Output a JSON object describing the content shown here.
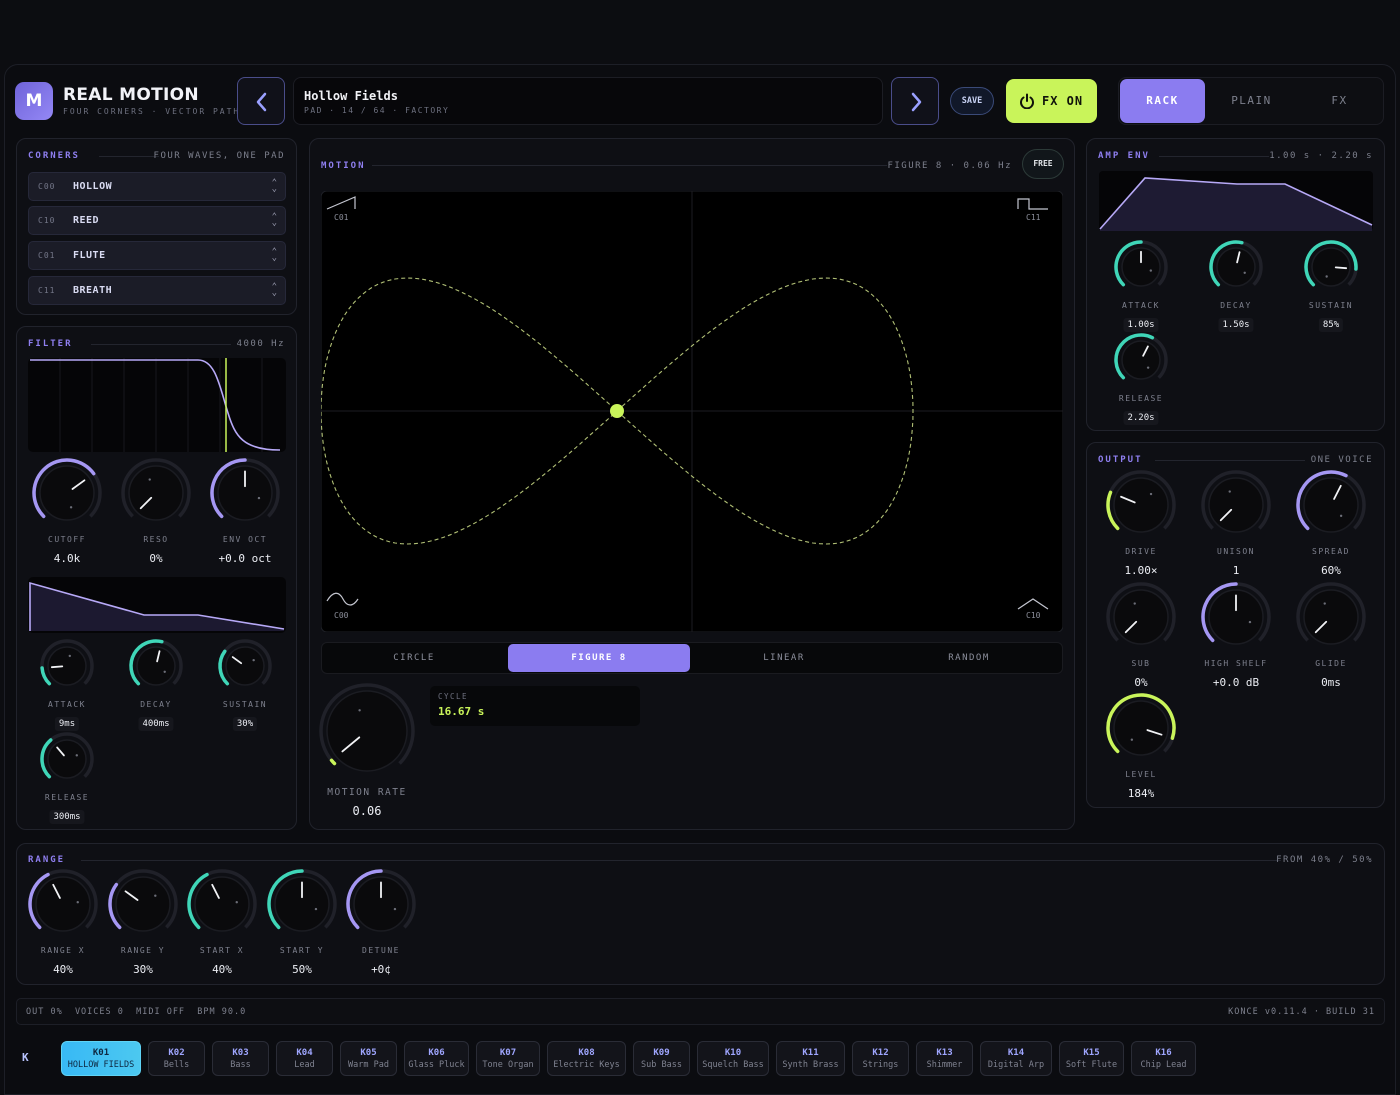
{
  "header": {
    "logo_letter": "M",
    "title": "REAL MOTION",
    "subtitle": "FOUR CORNERS · VECTOR PATH",
    "preset_name": "Hollow Fields",
    "preset_meta": "PAD · 14 / 64 · FACTORY",
    "save_label": "SAVE",
    "fx_label": "FX ON",
    "views": [
      "RACK",
      "PLAIN",
      "FX"
    ],
    "active_view": "RACK"
  },
  "corners": {
    "title": "CORNERS",
    "meta": "FOUR WAVES, ONE PAD",
    "items": [
      {
        "id": "C00",
        "name": "HOLLOW"
      },
      {
        "id": "C10",
        "name": "REED"
      },
      {
        "id": "C01",
        "name": "FLUTE"
      },
      {
        "id": "C11",
        "name": "BREATH"
      }
    ]
  },
  "filter": {
    "title": "FILTER",
    "meta": "4000 Hz",
    "knobs": [
      {
        "label": "CUTOFF",
        "value": "4.0k",
        "level": 0.7
      },
      {
        "label": "RESO",
        "value": "0%",
        "level": 0
      },
      {
        "label": "ENV OCT",
        "value": "+0.0 oct",
        "level": 0.5
      }
    ],
    "env_knobs": [
      {
        "label": "ATTACK",
        "value": "9ms",
        "level": 0.15
      },
      {
        "label": "DECAY",
        "value": "400ms",
        "level": 0.55
      },
      {
        "label": "SUSTAIN",
        "value": "30%",
        "level": 0.3
      },
      {
        "label": "RELEASE",
        "value": "300ms",
        "level": 0.35
      }
    ]
  },
  "motion": {
    "title": "MOTION",
    "meta": "FIGURE 8 · 0.06 Hz",
    "free_label": "FREE",
    "corner_labels": [
      "C01",
      "C11",
      "C00",
      "C10"
    ],
    "tabs": [
      "CIRCLE",
      "FIGURE 8",
      "LINEAR",
      "RANDOM"
    ],
    "active_tab": "FIGURE 8",
    "rate_label": "MOTION RATE",
    "rate_value": "0.06",
    "rate_level": 0.02,
    "cycle_label": "CYCLE",
    "cycle_value": "16.67 s"
  },
  "amp_env": {
    "title": "AMP ENV",
    "meta": "1.00 s · 2.20 s",
    "knobs": [
      {
        "label": "ATTACK",
        "value": "1.00s",
        "level": 0.5
      },
      {
        "label": "DECAY",
        "value": "1.50s",
        "level": 0.55
      },
      {
        "label": "SUSTAIN",
        "value": "85%",
        "level": 0.85
      },
      {
        "label": "RELEASE",
        "value": "2.20s",
        "level": 0.6
      }
    ]
  },
  "output": {
    "title": "OUTPUT",
    "meta": "ONE VOICE",
    "knobs": [
      {
        "label": "DRIVE",
        "value": "1.00×",
        "level": 0.25
      },
      {
        "label": "UNISON",
        "value": "1",
        "level": 0
      },
      {
        "label": "SPREAD",
        "value": "60%",
        "level": 0.6
      },
      {
        "label": "SUB",
        "value": "0%",
        "level": 0
      },
      {
        "label": "HIGH SHELF",
        "value": "+0.0 dB",
        "level": 0.5
      },
      {
        "label": "GLIDE",
        "value": "0ms",
        "level": 0
      },
      {
        "label": "LEVEL",
        "value": "184%",
        "level": 0.9
      }
    ]
  },
  "range": {
    "title": "RANGE",
    "meta": "FROM 40% / 50%",
    "knobs": [
      {
        "label": "RANGE X",
        "value": "40%",
        "level": 0.4
      },
      {
        "label": "RANGE Y",
        "value": "30%",
        "level": 0.3
      },
      {
        "label": "START X",
        "value": "40%",
        "level": 0.4
      },
      {
        "label": "START Y",
        "value": "50%",
        "level": 0.5
      },
      {
        "label": "DETUNE",
        "value": "+0¢",
        "level": 0.5
      }
    ]
  },
  "status": {
    "left": "OUT 0%  VOICES 0  MIDI OFF  BPM 90.0",
    "right": "KONCE v0.11.4 · BUILD 31"
  },
  "presets": {
    "brand": "K",
    "items": [
      {
        "num": "K01",
        "name": "HOLLOW FIELDS"
      },
      {
        "num": "K02",
        "name": "Bells"
      },
      {
        "num": "K03",
        "name": "Bass"
      },
      {
        "num": "K04",
        "name": "Lead"
      },
      {
        "num": "K05",
        "name": "Warm Pad"
      },
      {
        "num": "K06",
        "name": "Glass Pluck"
      },
      {
        "num": "K07",
        "name": "Tone Organ"
      },
      {
        "num": "K08",
        "name": "Electric Keys"
      },
      {
        "num": "K09",
        "name": "Sub Bass"
      },
      {
        "num": "K10",
        "name": "Squelch Bass"
      },
      {
        "num": "K11",
        "name": "Synth Brass"
      },
      {
        "num": "K12",
        "name": "Strings"
      },
      {
        "num": "K13",
        "name": "Shimmer"
      },
      {
        "num": "K14",
        "name": "Digital Arp"
      },
      {
        "num": "K15",
        "name": "Soft Flute"
      },
      {
        "num": "K16",
        "name": "Chip Lead"
      }
    ]
  },
  "colors": {
    "accent": "#8b7cf0",
    "fx": "#c9f45a",
    "teal": "#3fd6b8",
    "preset_active": "#3fbdf2"
  }
}
